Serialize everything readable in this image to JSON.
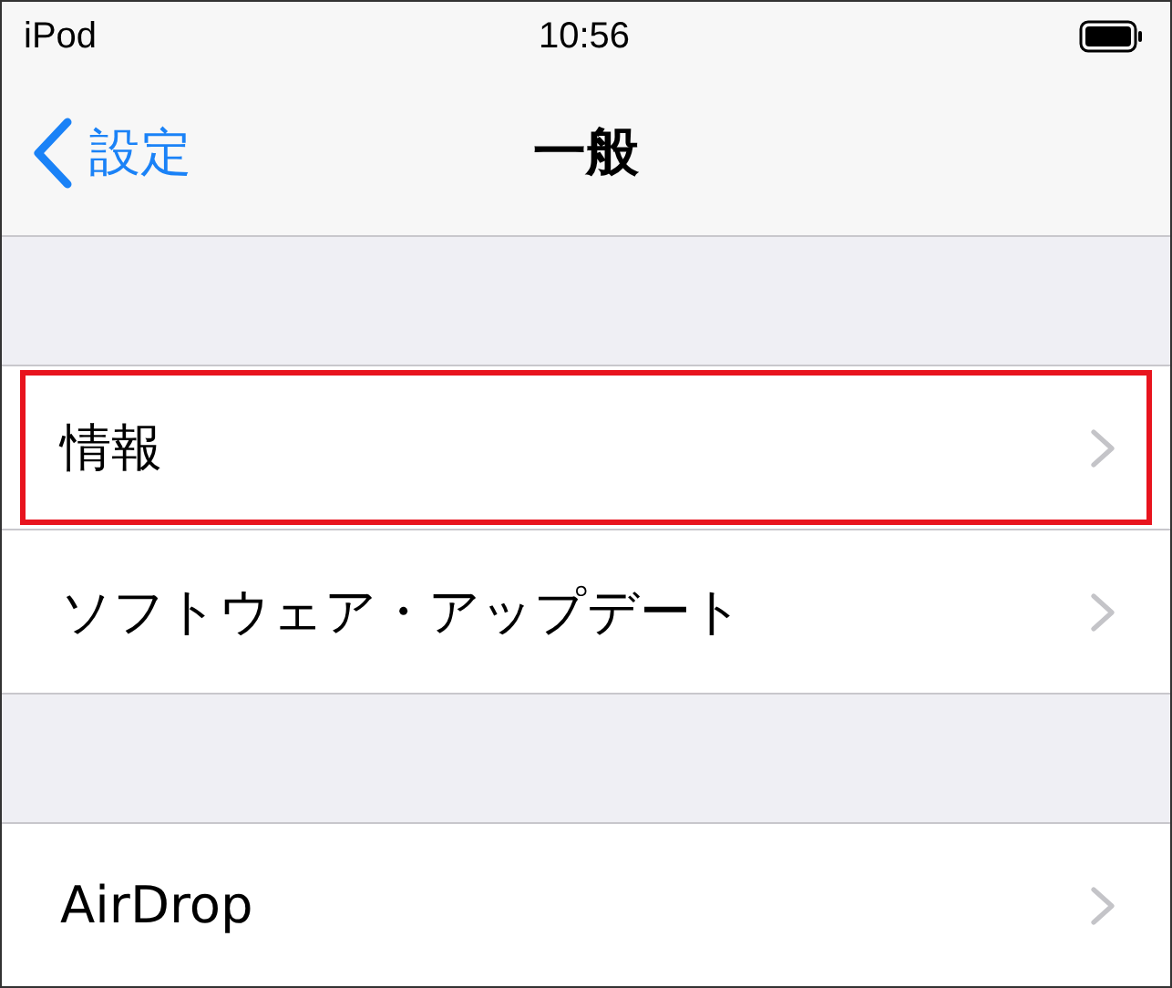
{
  "status_bar": {
    "carrier": "iPod",
    "time": "10:56"
  },
  "nav": {
    "back": "設定",
    "title": "一般"
  },
  "groups": [
    {
      "rows": [
        {
          "label": "情報",
          "highlighted": true
        },
        {
          "label": "ソフトウェア・アップデート",
          "highlighted": false
        }
      ]
    },
    {
      "rows": [
        {
          "label": "AirDrop",
          "highlighted": false
        }
      ]
    }
  ]
}
